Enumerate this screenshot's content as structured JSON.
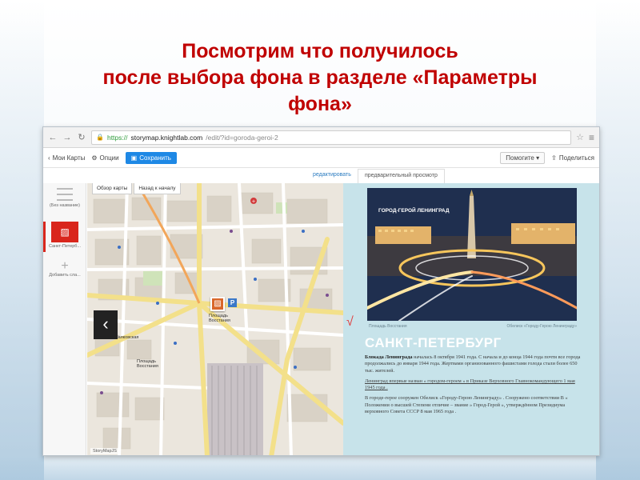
{
  "slide": {
    "title_lines": [
      "Посмотрим что получилось",
      "после выбора фона в разделе «Параметры",
      "фона»"
    ],
    "colors": {
      "title": "#c00000",
      "accent_red": "#d9261c",
      "save_blue": "#1e88e5",
      "story_bg": "#c7e3ea"
    }
  },
  "browser": {
    "scheme": "https://",
    "host": "storymap.knightlab.com",
    "path": "/edit/?id=goroda-geroi-2",
    "icons": [
      "back-arrow-icon",
      "forward-arrow-icon",
      "reload-icon",
      "lock-icon",
      "star-icon",
      "menu-icon"
    ]
  },
  "app_toolbar": {
    "my_maps": "Мои Карты",
    "options": "Опции",
    "save": "Сохранить",
    "help": "Помогите",
    "share": "Поделиться"
  },
  "view_tabs": {
    "edit": "редактировать",
    "preview": "предварительный просмотр"
  },
  "slide_list": {
    "items": [
      {
        "label": "(Без название)",
        "icon": "text-lines-icon"
      },
      {
        "label": "Санкт-Петерб...",
        "icon": "image-icon"
      },
      {
        "label": "Добавить сла...",
        "icon": "plus-icon"
      }
    ]
  },
  "map": {
    "tabs": [
      "Обзор карты",
      "Назад к началу"
    ],
    "credit": "StoryMapJS",
    "labels": [
      "Площадь Восстания",
      "Маяковская",
      "Площадь Восстания"
    ],
    "back_arrow": "‹"
  },
  "story": {
    "photo_text": "ГОРОД-ГЕРОЙ ЛЕНИНГРАД",
    "caption_left": "Площадь Восстания",
    "caption_right": "Обелиск «Городу-Герою Ленинграду»",
    "title": "САНКТ-ПЕТЕРБУРГ",
    "para1_bold": "Блокада Ленинграда",
    "para1_rest": " началась 8 октября 1941 года. С начала и до конца 1944 года почти все города продолжались до января 1944 года. Жертвами организованного фашистами голода стали более 650 тыс. жителей.",
    "para2": "Ленинград впервые назван « городом-героем » в Приказе Верховного Главнокомандующего 1 мая 1945 года .",
    "para3": "В городе-герое сооружен Обелиск «Городу-Герою Ленинграду» . Сооружено соответствии В « Положении о высшей Степени отличие – звание » Город-Герой », утверждённом Президиума верховного Совета СССР 8 мая 1965 года ."
  }
}
